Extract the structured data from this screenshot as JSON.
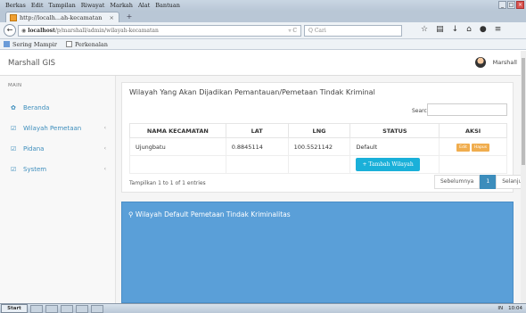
{
  "browser": {
    "menu": [
      "Berkas",
      "Edit",
      "Tampilan",
      "Riwayat",
      "Markah",
      "Alat",
      "Bantuan"
    ],
    "tab_title": "http://localh...ah-kecamatan",
    "tab_close": "×",
    "new_tab": "+",
    "url_host": "localhost",
    "url_path": "/p/marshall/admin/wilayah-kecamatan",
    "url_icons": "▿ C",
    "search_placeholder": "Q Cari",
    "bookmarks": [
      "Sering Mampir",
      "Perkenalan"
    ]
  },
  "app": {
    "brand": "Marshall GIS",
    "user_name": "Marshall"
  },
  "sidebar": {
    "section": "MAIN",
    "items": [
      {
        "label": "Beranda",
        "icon": "dashboard-icon",
        "has_chevron": false
      },
      {
        "label": "Wilayah Pemetaan",
        "icon": "edit-icon",
        "has_chevron": true
      },
      {
        "label": "Pidana",
        "icon": "edit-icon",
        "has_chevron": true
      },
      {
        "label": "System",
        "icon": "edit-icon",
        "has_chevron": true
      }
    ]
  },
  "panel": {
    "title": "Wilayah Yang Akan Dijadikan Pemantauan/Pemetaan Tindak Kriminal",
    "search_label": "Search:",
    "columns": [
      "NAMA KECAMATAN",
      "LAT",
      "LNG",
      "STATUS",
      "AKSI"
    ],
    "rows": [
      {
        "nama": "Ujungbatu",
        "lat": "0.8845114",
        "lng": "100.5521142",
        "status": "Default",
        "edit": "Edit",
        "hapus": "Hapus"
      }
    ],
    "add_button": "+ Tambah Wilayah",
    "info": "Tampilkan 1 to 1 of 1 entries",
    "pager": {
      "prev": "Sebelumnya",
      "page": "1",
      "next": "Selanjutnya"
    }
  },
  "panel2": {
    "title": "Wilayah Default Pemetaan Tindak Kriminalitas"
  },
  "taskbar": {
    "start": "Start",
    "tray": [
      "IN",
      "10:04"
    ]
  },
  "colors": {
    "accent": "#3c8dbc",
    "add_button": "#1ab0d9",
    "action_button": "#f0ad4e",
    "panel2": "#5a9fd8"
  }
}
